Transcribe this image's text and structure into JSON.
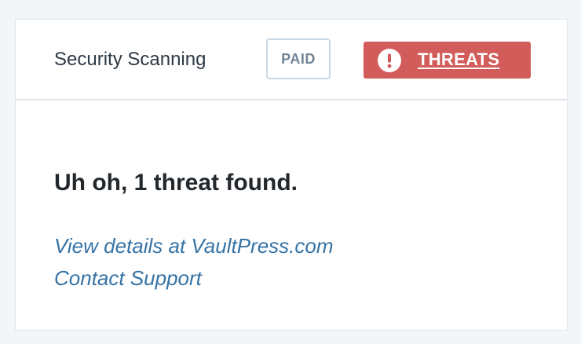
{
  "card": {
    "title": "Security Scanning",
    "plan_badge": "PAID",
    "threats_button": {
      "label": "THREATS",
      "icon": "alert-icon",
      "color": "#d15c59"
    },
    "message": "Uh oh, 1 threat found.",
    "links": {
      "details": "View details at VaultPress.com",
      "support": "Contact Support"
    },
    "colors": {
      "link": "#3673a5",
      "badge_border": "#c8d7e1"
    }
  }
}
